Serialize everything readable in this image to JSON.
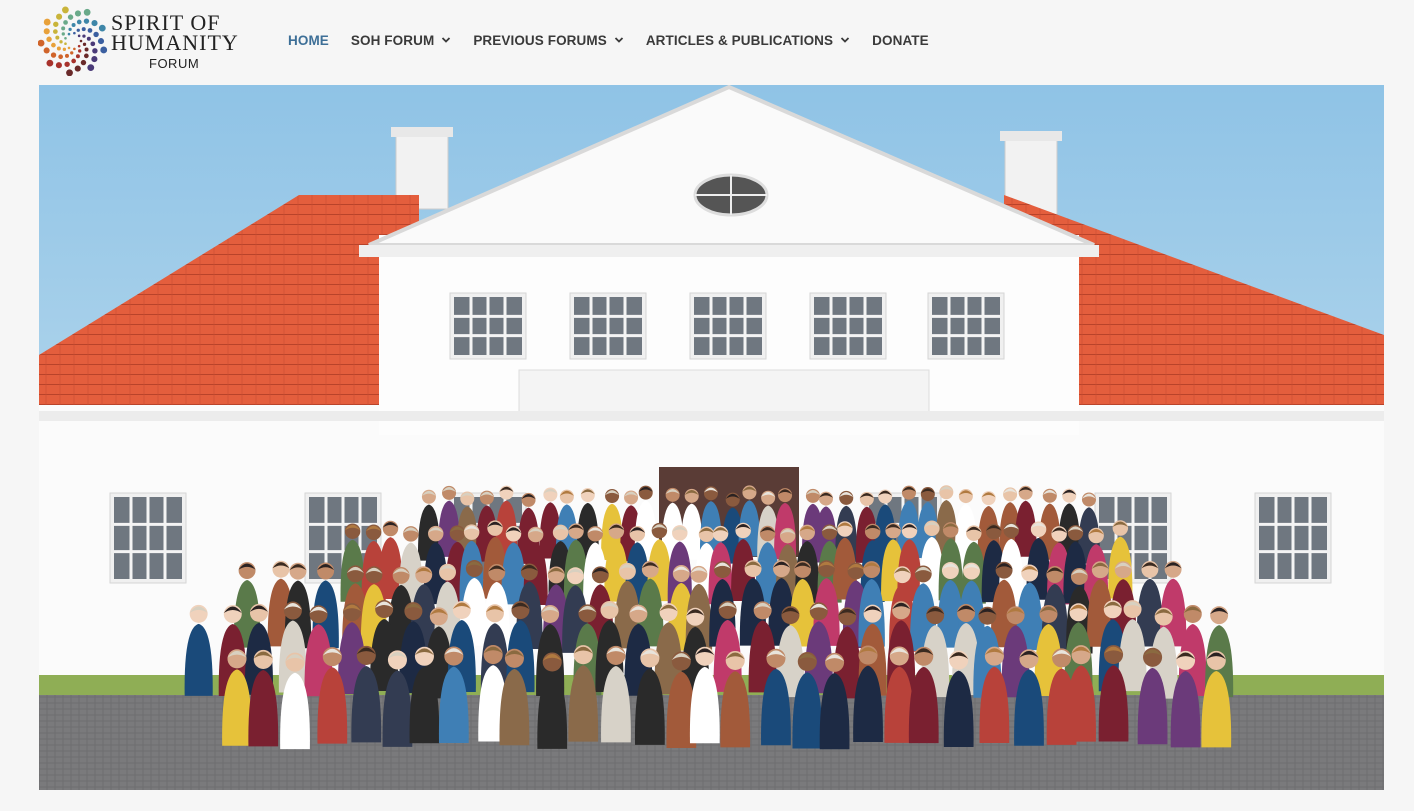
{
  "brand": {
    "line1": "SPIRIT OF",
    "line2": "HUMANITY",
    "line3": "FORUM"
  },
  "nav": {
    "items": [
      {
        "label": "HOME",
        "active": true,
        "has_dropdown": false
      },
      {
        "label": "SOH FORUM",
        "active": false,
        "has_dropdown": true
      },
      {
        "label": "PREVIOUS FORUMS",
        "active": false,
        "has_dropdown": true
      },
      {
        "label": "ARTICLES & PUBLICATIONS",
        "active": false,
        "has_dropdown": true
      },
      {
        "label": "DONATE",
        "active": false,
        "has_dropdown": false
      }
    ]
  },
  "colors": {
    "nav_active": "#3d6f97",
    "nav_text": "#3a3a3a",
    "roof": "#e0583a",
    "sky": "#a9cfe6"
  },
  "icons": {
    "dropdown": "chevron-down-icon",
    "logo": "spiral-dots-logo-icon"
  }
}
